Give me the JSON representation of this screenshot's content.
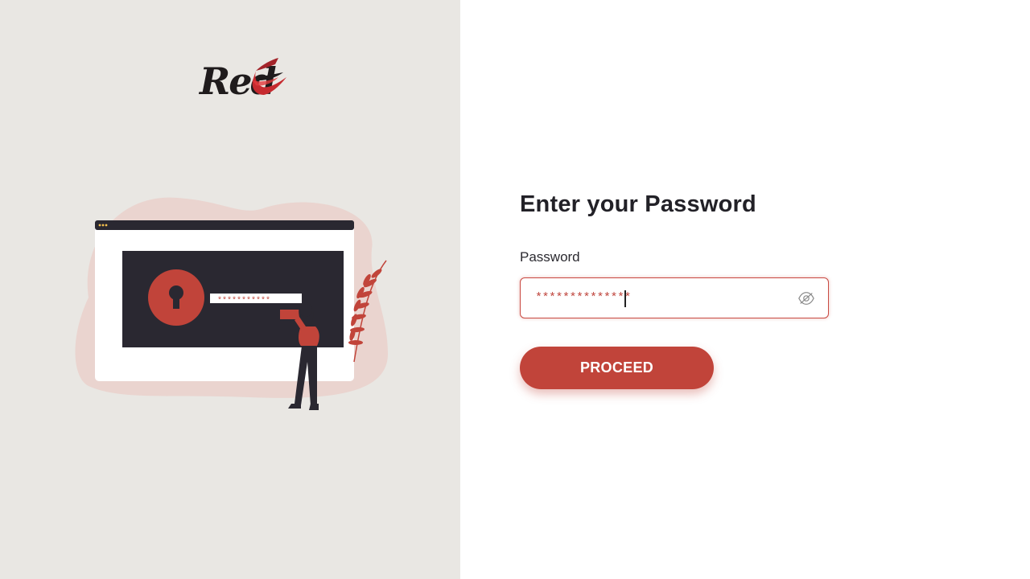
{
  "brand": {
    "logo_text": "Red",
    "logo_mark_letter": "E",
    "accent_color": "#c1443a"
  },
  "illustration": {
    "masked_password": "***********"
  },
  "form": {
    "title": "Enter your Password",
    "password_label": "Password",
    "password_value": "**************",
    "toggle_icon": "eye-slash-icon",
    "proceed_label": "PROCEED"
  }
}
